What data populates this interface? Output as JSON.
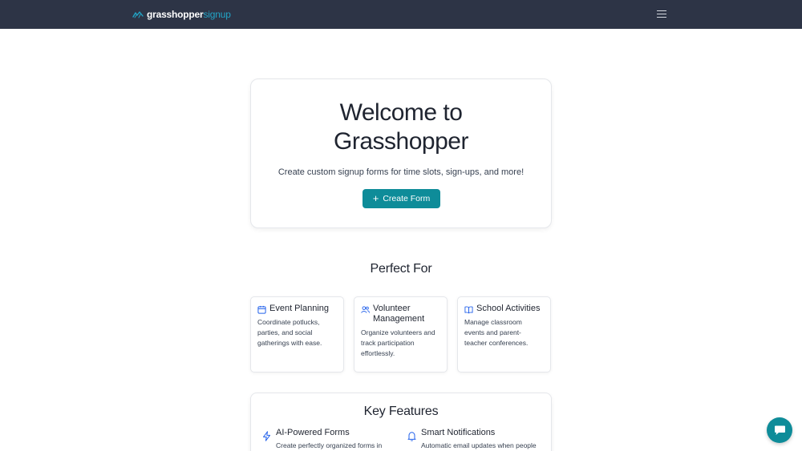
{
  "header": {
    "logo_primary": "grasshopper",
    "logo_secondary": "signup",
    "menu_icon": "hamburger-menu-icon"
  },
  "hero": {
    "title_line1": "Welcome to",
    "title_line2": "Grasshopper",
    "subtitle": "Create custom signup forms for time slots, sign-ups, and more!",
    "create_button": "Create Form"
  },
  "perfect_for": {
    "title": "Perfect For",
    "cards": [
      {
        "icon": "calendar-icon",
        "title": "Event Planning",
        "description": "Coordinate potlucks, parties, and social gatherings with ease."
      },
      {
        "icon": "users-icon",
        "title": "Volunteer Management",
        "description": "Organize volunteers and track participation effortlessly."
      },
      {
        "icon": "book-icon",
        "title": "School Activities",
        "description": "Manage classroom events and parent-teacher conferences."
      }
    ]
  },
  "key_features": {
    "title": "Key Features",
    "items": [
      {
        "icon": "lightning-icon",
        "title": "AI-Powered Forms",
        "description": "Create perfectly organized forms in"
      },
      {
        "icon": "bell-icon",
        "title": "Smart Notifications",
        "description": "Automatic email updates when people"
      }
    ]
  },
  "colors": {
    "header_bg": "#2d3446",
    "accent": "#0e8c99",
    "logo_accent": "#22a4c6"
  },
  "chat": {
    "icon": "chat-bubble-icon"
  }
}
